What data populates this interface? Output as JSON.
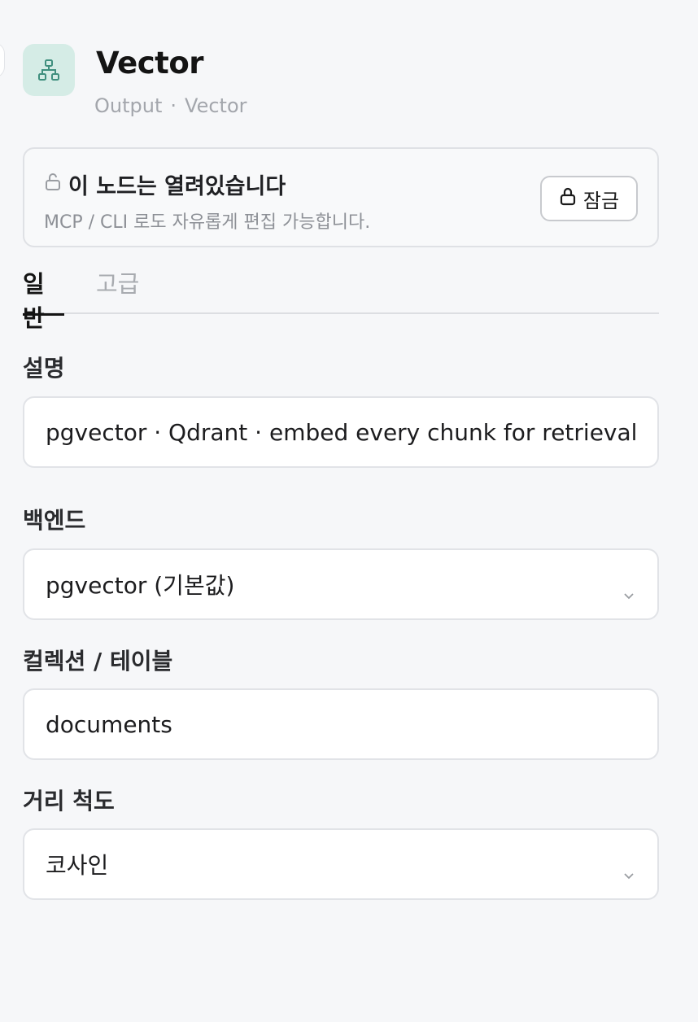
{
  "header": {
    "title": "Vector",
    "subtitle_category": "Output",
    "subtitle_separator": "·",
    "subtitle_type": "Vector",
    "icon": "hierarchy-icon",
    "icon_bg": "#d5ece6",
    "icon_color": "#3f8f7e"
  },
  "lock_notice": {
    "title": "이 노드는 열려있습니다",
    "description": "MCP / CLI 로도 자유롭게 편집 가능합니다.",
    "lock_button_label": "잠금"
  },
  "tabs": [
    {
      "label": "일반",
      "active": true
    },
    {
      "label": "고급",
      "active": false
    }
  ],
  "fields": {
    "description": {
      "label": "설명",
      "value": "pgvector · Qdrant · embed every chunk for retrieval"
    },
    "backend": {
      "label": "백엔드",
      "value": "pgvector (기본값)"
    },
    "collection": {
      "label": "컬렉션 / 테이블",
      "value": "documents"
    },
    "distance": {
      "label": "거리 척도",
      "value": "코사인"
    }
  }
}
